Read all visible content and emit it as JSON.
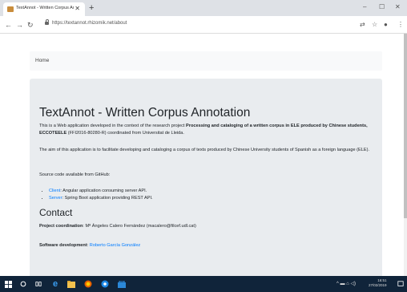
{
  "browser": {
    "tab_title": "TextAnnot - Written Corpus Anno",
    "tab_close": "✕",
    "new_tab": "+",
    "window_controls": {
      "minimize": "–",
      "maximize": "☐",
      "close": "✕"
    },
    "url": "https://textannot.rhizomik.net/about",
    "icons": [
      "back-arrow-icon",
      "forward-arrow-icon",
      "reload-icon",
      "lock-icon",
      "translate-icon",
      "star-icon",
      "profile-icon",
      "menu-icon"
    ]
  },
  "navbar": {
    "home": "Home"
  },
  "page": {
    "title": "TextAnnot - Written Corpus Annotation",
    "intro_prefix": "This is a Web application developed in the context of the research project ",
    "intro_bold": "Processing and cataloging of a written corpus in ELE produced by Chinese students, ECCOTEELE",
    "intro_suffix": " (FFI2016-80280-R) coordinated from Universitat de Lleida.",
    "aim": "The aim of this application is to facilitate developing and cataloging a corpus of texts produced by Chinese University students of Spanish as a foreign language (ELE).",
    "source_intro": "Source code available from GitHub:",
    "links": [
      {
        "label": "Client",
        "text": ": Angular application consuming server API."
      },
      {
        "label": "Server",
        "text": ": Spring Boot application providing REST API."
      }
    ],
    "contact_heading": "Contact",
    "coordination_label": "Project coordination",
    "coordination_text": ": Mª Ángeles Calero Fernández (macalero@filcef.udl.cat)",
    "development_label": "Software development",
    "development_link": "Roberto García González"
  },
  "taskbar": {
    "time": "16:51",
    "date": "27/02/2019",
    "colors": {
      "background": "#10243a",
      "accent": "#1e88e5"
    }
  }
}
